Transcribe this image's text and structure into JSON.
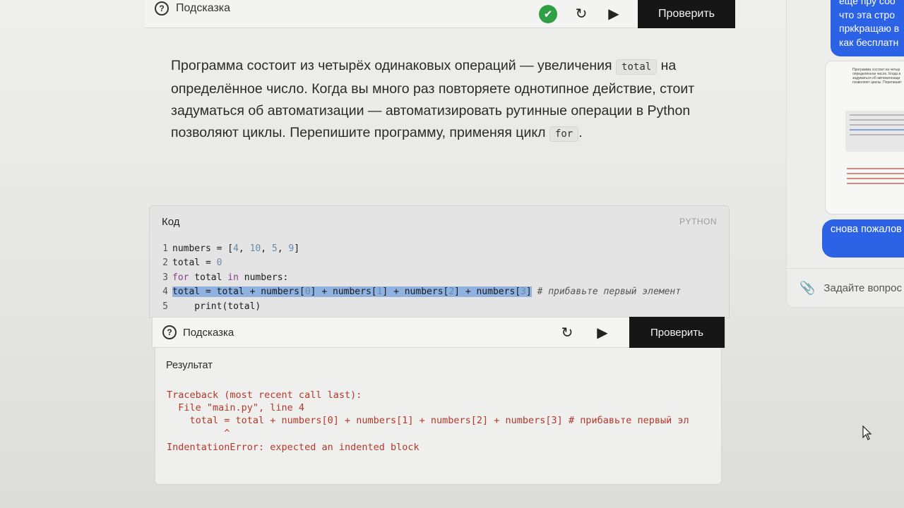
{
  "top_toolbar": {
    "hint_label": "Подсказка",
    "check_button_label": "Проверить"
  },
  "description": {
    "part1": "Программа состоит из четырёх одинаковых операций — увеличения ",
    "code1": "total",
    "part2": " на определённое число. Когда вы много раз повторяете однотипное действие, стоит задуматься об автоматизации — автоматизировать рутинные операции в Python позволяют циклы. Перепишите программу, применяя цикл ",
    "code2": "for",
    "part3": "."
  },
  "code_panel": {
    "title": "Код",
    "language": "PYTHON",
    "lines": [
      {
        "n": "1",
        "text": "numbers = [4, 10, 5, 9]"
      },
      {
        "n": "2",
        "text": "total = 0"
      },
      {
        "n": "3",
        "text": "for total in numbers:"
      },
      {
        "n": "4",
        "text": "total = total + numbers[0] + numbers[1] + numbers[2] + numbers[3] # прибавьте первый элемент"
      },
      {
        "n": "5",
        "text": "    print(total)"
      }
    ]
  },
  "action_bar": {
    "hint_label": "Подсказка",
    "check_button_label": "Проверить"
  },
  "result": {
    "title": "Результат",
    "lines": [
      "Traceback (most recent call last):",
      "  File \"main.py\", line 4",
      "    total = total + numbers[0] + numbers[1] + numbers[2] + numbers[3] # прибавьте первый эл",
      "          ^",
      "IndentationError: expected an indented block"
    ]
  },
  "chat": {
    "top_bubble_lines": [
      "еще пру соо",
      "что эта стро",
      "пркkращаю в",
      "как бесплатн"
    ],
    "screenshot_text": "Программа состоит из четыр определённое число. Когда в задуматься об автоматизаци позволяют циклы. Перепишит",
    "mid_bubble": "снова пожалов",
    "input_placeholder": "Задайте вопрос"
  },
  "colors": {
    "accent_blue": "#2c63e6",
    "success_green": "#2ea043",
    "error_red": "#b3392b",
    "dark_button": "#161616",
    "selection": "#8fb2e0"
  }
}
